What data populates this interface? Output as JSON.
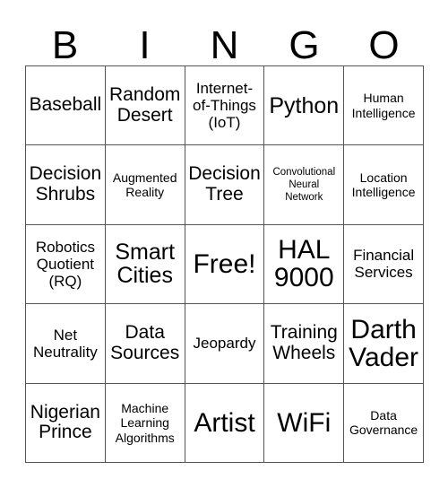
{
  "card": {
    "header_letters": [
      "B",
      "I",
      "N",
      "G",
      "O"
    ],
    "columns": 5,
    "rows": 5,
    "border_color": "#555555",
    "text_color": "#000000",
    "background_color": "#ffffff",
    "free_space_label": "Free!",
    "free_space_index": 12,
    "cells": [
      {
        "text": "Baseball",
        "size": "sz-l"
      },
      {
        "text": "Random\nDesert",
        "size": "sz-l"
      },
      {
        "text": "Internet-\nof-Things\n(IoT)",
        "size": "sz-m"
      },
      {
        "text": "Python",
        "size": "sz-xl"
      },
      {
        "text": "Human\nIntelligence",
        "size": "sz-s"
      },
      {
        "text": "Decision\nShrubs",
        "size": "sz-l"
      },
      {
        "text": "Augmented\nReality",
        "size": "sz-s"
      },
      {
        "text": "Decision\nTree",
        "size": "sz-l"
      },
      {
        "text": "Convolutional\nNeural\nNetwork",
        "size": "sz-xs"
      },
      {
        "text": "Location\nIntelligence",
        "size": "sz-s"
      },
      {
        "text": "Robotics\nQuotient\n(RQ)",
        "size": "sz-m"
      },
      {
        "text": "Smart\nCities",
        "size": "sz-xl"
      },
      {
        "text": "Free!",
        "size": "sz-xxl"
      },
      {
        "text": "HAL\n9000",
        "size": "sz-xxl"
      },
      {
        "text": "Financial\nServices",
        "size": "sz-m"
      },
      {
        "text": "Net\nNeutrality",
        "size": "sz-m"
      },
      {
        "text": "Data\nSources",
        "size": "sz-l"
      },
      {
        "text": "Jeopardy",
        "size": "sz-m"
      },
      {
        "text": "Training\nWheels",
        "size": "sz-l"
      },
      {
        "text": "Darth\nVader",
        "size": "sz-xxl"
      },
      {
        "text": "Nigerian\nPrince",
        "size": "sz-l"
      },
      {
        "text": "Machine\nLearning\nAlgorithms",
        "size": "sz-s"
      },
      {
        "text": "Artist",
        "size": "sz-xxl"
      },
      {
        "text": "WiFi",
        "size": "sz-xxl"
      },
      {
        "text": "Data\nGovernance",
        "size": "sz-s"
      }
    ]
  }
}
